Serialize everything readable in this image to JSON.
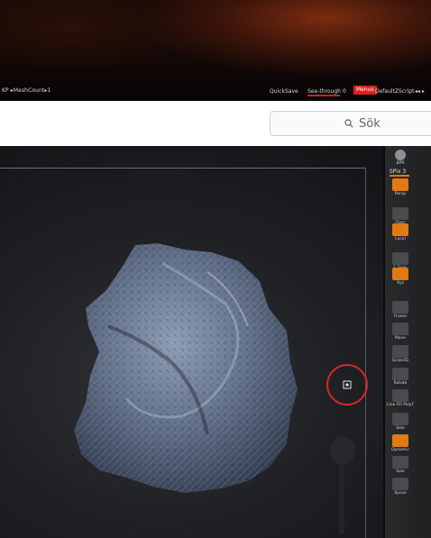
{
  "zbrush_bar": {
    "breadcrumb": "KP ▸MeshCount▸1",
    "quicksave": "QuickSave",
    "see_through_label": "See-through",
    "see_through_value": "0",
    "menus_label": "Menus",
    "default_zscript": "DefaultZScript",
    "arrows": "◂◂ ▸"
  },
  "search": {
    "placeholder": "Sök"
  },
  "palette": {
    "brush_label": "BPR",
    "spix_label": "SPix 3",
    "items": [
      {
        "label": "Persp",
        "style": "orange"
      },
      {
        "label": "Floor",
        "style": "dark"
      },
      {
        "label": "Local",
        "style": "orange"
      },
      {
        "label": "L.Sym",
        "style": "dark"
      },
      {
        "label": "Xyz",
        "style": "orange"
      },
      {
        "label": "Frame",
        "style": "dark"
      },
      {
        "label": "Move",
        "style": "dark"
      },
      {
        "label": "Scale3D",
        "style": "dark"
      },
      {
        "label": "Rotate",
        "style": "dark"
      },
      {
        "label": "Line Fill PolyF",
        "style": "dark"
      },
      {
        "label": "Solo",
        "style": "dark"
      },
      {
        "label": "Dynamic",
        "style": "orange"
      },
      {
        "label": "Solo",
        "style": "dark"
      },
      {
        "label": "Xpose",
        "style": "dark"
      }
    ]
  },
  "colors": {
    "accent_orange": "#e07a12",
    "accent_red": "#d8242a",
    "palette_bg": "#242527"
  },
  "icons": {
    "search": "search-icon",
    "cursor": "sculpt-cursor-icon"
  }
}
